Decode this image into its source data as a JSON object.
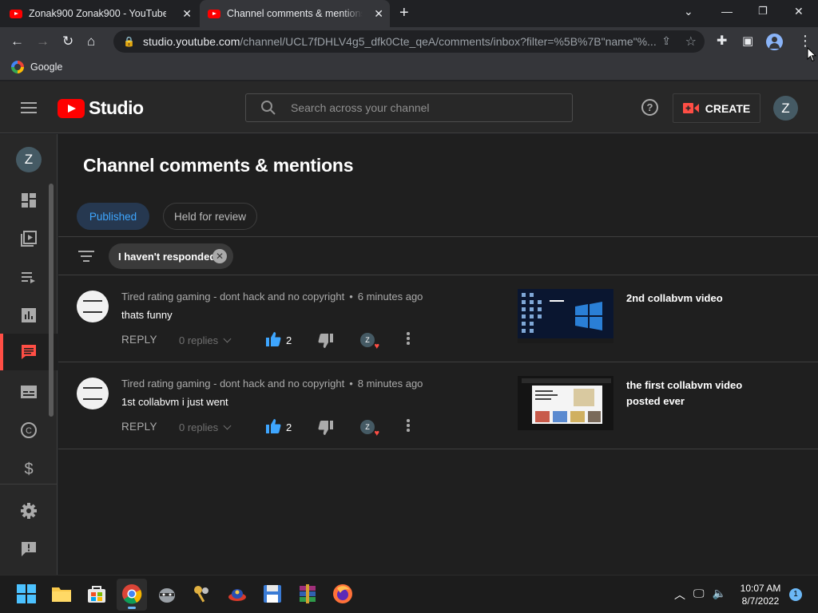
{
  "browser": {
    "tabs": [
      {
        "title": "Zonak900 Zonak900 - YouTube",
        "active": false
      },
      {
        "title": "Channel comments & mentions",
        "active": true
      }
    ],
    "url_host": "studio.youtube.com",
    "url_path": "/channel/UCL7fDHLV4g5_dfk0Cte_qeA/comments/inbox?filter=%5B%7B\"name\"%...",
    "bookmarks": [
      {
        "label": "Google"
      }
    ]
  },
  "header": {
    "logo_text": "Studio",
    "search_placeholder": "Search across your channel",
    "create_label": "CREATE",
    "avatar_letter": "Z"
  },
  "nav": {
    "avatar_letter": "Z",
    "items": [
      {
        "name": "dashboard",
        "icon": "dashboard-icon"
      },
      {
        "name": "content",
        "icon": "content-icon"
      },
      {
        "name": "playlists",
        "icon": "playlists-icon"
      },
      {
        "name": "analytics",
        "icon": "analytics-icon"
      },
      {
        "name": "comments",
        "icon": "comments-icon",
        "active": true
      },
      {
        "name": "subtitles",
        "icon": "subtitles-icon"
      },
      {
        "name": "copyright",
        "icon": "copyright-icon"
      },
      {
        "name": "earn",
        "icon": "dollar-icon"
      },
      {
        "name": "settings",
        "icon": "gear-icon"
      },
      {
        "name": "feedback",
        "icon": "feedback-icon"
      }
    ]
  },
  "page": {
    "title": "Channel comments & mentions",
    "tabs": [
      {
        "label": "Published",
        "active": true
      },
      {
        "label": "Held for review",
        "active": false
      }
    ],
    "filter_label": "I haven't responded"
  },
  "comments": [
    {
      "author": "Tired rating gaming - dont hack and no copyright",
      "time": "6 minutes ago",
      "text": "thats funny",
      "reply_label": "REPLY",
      "replies": "0 replies",
      "likes": "2",
      "creator_heart_letter": "Z",
      "video_title": "2nd collabvm video"
    },
    {
      "author": "Tired rating gaming - dont hack and no copyright",
      "time": "8 minutes ago",
      "text": "1st collabvm i just went",
      "reply_label": "REPLY",
      "replies": "0 replies",
      "likes": "2",
      "creator_heart_letter": "Z",
      "video_title": "the first collabvm video posted ever"
    }
  ],
  "taskbar": {
    "time": "10:07 AM",
    "date": "8/7/2022",
    "notification_count": "1"
  },
  "colors": {
    "accent_blue": "#3ea6ff",
    "brand_red": "#ff0000",
    "active_nav": "#ff4e45"
  }
}
